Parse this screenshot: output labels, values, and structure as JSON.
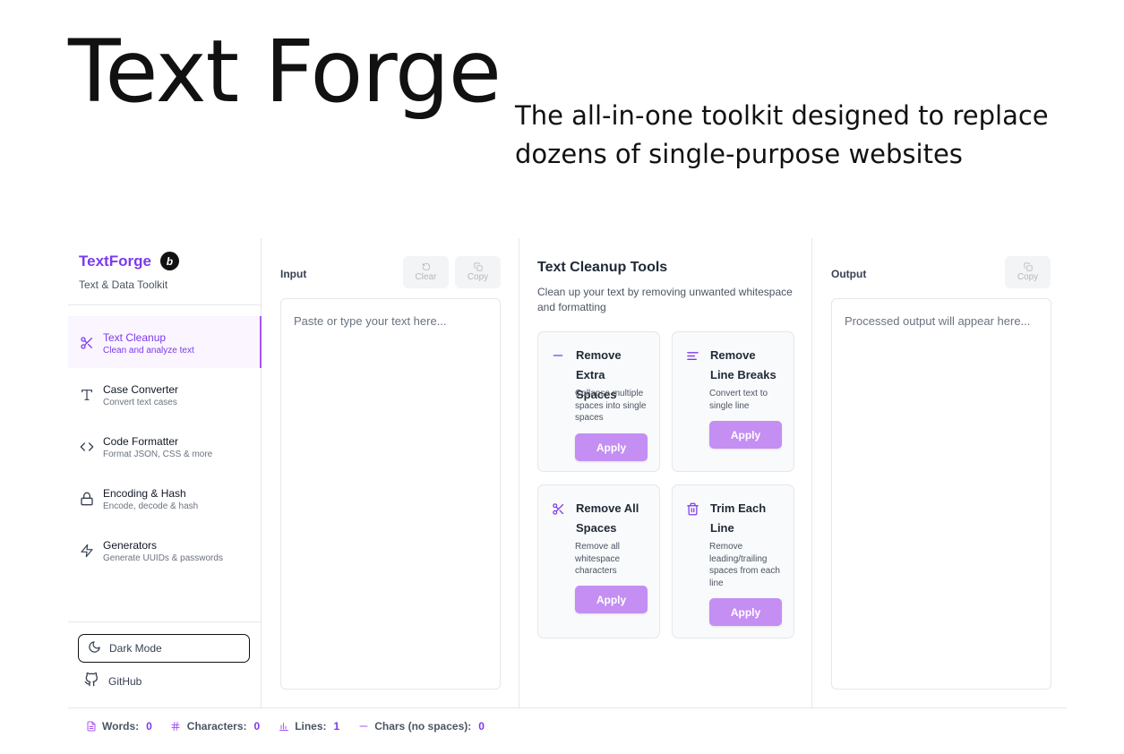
{
  "hero": {
    "title": "Text Forge",
    "subtitle": "The all-in-one toolkit designed to replace dozens of single-purpose websites"
  },
  "brand": {
    "name": "TextForge",
    "badge": "b",
    "tagline": "Text & Data Toolkit"
  },
  "nav": {
    "items": [
      {
        "label": "Text Cleanup",
        "desc": "Clean and analyze text",
        "icon": "scissors-icon",
        "active": true
      },
      {
        "label": "Case Converter",
        "desc": "Convert text cases",
        "icon": "type-icon"
      },
      {
        "label": "Code Formatter",
        "desc": "Format JSON, CSS & more",
        "icon": "code-icon"
      },
      {
        "label": "Encoding & Hash",
        "desc": "Encode, decode & hash",
        "icon": "lock-icon"
      },
      {
        "label": "Generators",
        "desc": "Generate UUIDs & passwords",
        "icon": "zap-icon"
      }
    ],
    "dark_mode": "Dark Mode",
    "github": "GitHub"
  },
  "input": {
    "label": "Input",
    "clear": "Clear",
    "copy": "Copy",
    "placeholder": "Paste or type your text here..."
  },
  "tools": {
    "title": "Text Cleanup Tools",
    "desc": "Clean up your text by removing unwanted whitespace and formatting",
    "cards": [
      {
        "title": "Remove Extra Spaces",
        "desc": "Collapse multiple spaces into single spaces",
        "icon": "minus-icon",
        "button": "Apply"
      },
      {
        "title": "Remove Line Breaks",
        "desc": "Convert text to single line",
        "icon": "align-left-icon",
        "button": "Apply"
      },
      {
        "title": "Remove All Spaces",
        "desc": "Remove all whitespace characters",
        "icon": "scissors-icon",
        "button": "Apply"
      },
      {
        "title": "Trim Each Line",
        "desc": "Remove leading/trailing spaces from each line",
        "icon": "trash-icon",
        "button": "Apply"
      }
    ]
  },
  "output": {
    "label": "Output",
    "copy": "Copy",
    "placeholder": "Processed output will appear here..."
  },
  "stats": {
    "words_label": "Words:",
    "words": "0",
    "chars_label": "Characters:",
    "chars": "0",
    "lines_label": "Lines:",
    "lines": "1",
    "nospace_label": "Chars (no spaces):",
    "nospace": "0"
  },
  "colors": {
    "accent": "#7c3aed",
    "accent_light": "#a855f7",
    "apply_button": "#c48ef3",
    "active_bg": "#faf5ff"
  }
}
